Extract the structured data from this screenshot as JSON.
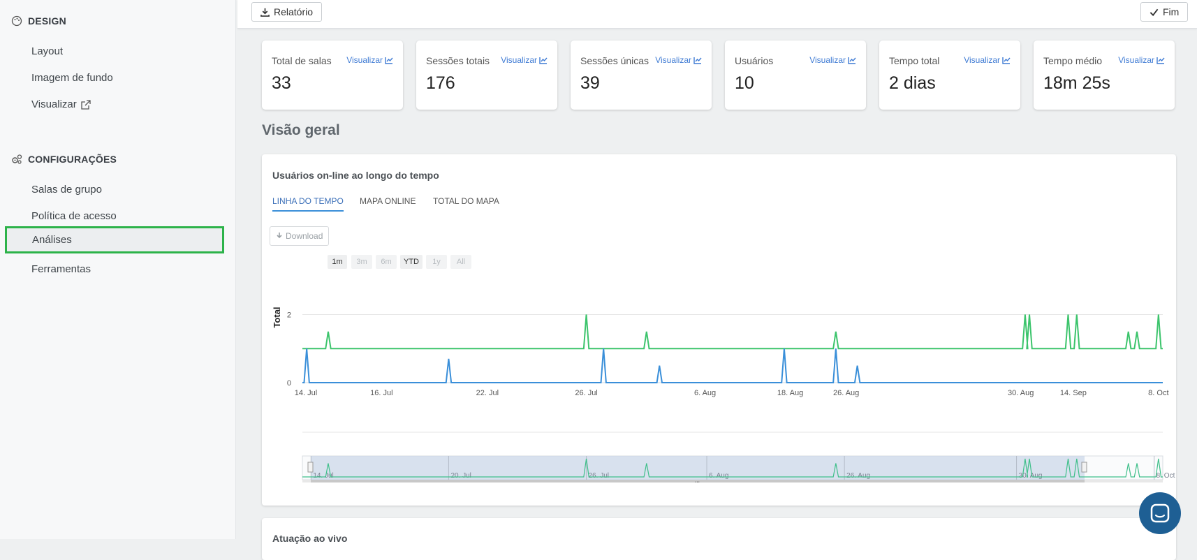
{
  "sidebar": {
    "design": {
      "title": "DESIGN",
      "icon": "palette-icon",
      "items": [
        {
          "label": "Layout"
        },
        {
          "label": "Imagem de fundo"
        },
        {
          "label": "Visualizar",
          "icon": "external-link-icon"
        }
      ]
    },
    "config": {
      "title": "CONFIGURAÇÕES",
      "icon": "gears-icon",
      "items": [
        {
          "label": "Salas de grupo"
        },
        {
          "label": "Política de acesso"
        },
        {
          "label": "Análises",
          "active": true
        },
        {
          "label": "Ferramentas"
        }
      ]
    }
  },
  "toolbar": {
    "report_label": "Relatório",
    "finish_label": "Fim"
  },
  "stats": [
    {
      "label": "Total de salas",
      "value": "33",
      "link": "Visualizar"
    },
    {
      "label": "Sessões totais",
      "value": "176",
      "link": "Visualizar"
    },
    {
      "label": "Sessões únicas",
      "value": "39",
      "link": "Visualizar"
    },
    {
      "label": "Usuários",
      "value": "10",
      "link": "Visualizar"
    },
    {
      "label": "Tempo total",
      "value": "2 dias",
      "link": "Visualizar"
    },
    {
      "label": "Tempo médio",
      "value": "18m 25s",
      "link": "Visualizar"
    }
  ],
  "overview_title": "Visão geral",
  "panel": {
    "title": "Usuários on-line ao longo do tempo",
    "tabs": [
      {
        "label": "LINHA DO TEMPO",
        "active": true
      },
      {
        "label": "MAPA ONLINE"
      },
      {
        "label": "TOTAL DO MAPA"
      }
    ],
    "download_label": "Download",
    "ranges": [
      {
        "label": "1m",
        "enabled": true
      },
      {
        "label": "3m",
        "enabled": false
      },
      {
        "label": "6m",
        "enabled": false
      },
      {
        "label": "YTD",
        "enabled": true
      },
      {
        "label": "1y",
        "enabled": false
      },
      {
        "label": "All",
        "enabled": false
      }
    ]
  },
  "panel2_title": "Atuação ao vivo",
  "colors": {
    "green_series": "#3cc46c",
    "blue_series": "#3a8fd9",
    "active_outline": "#2db34a",
    "link": "#3f7bd4",
    "chat": "#1e5f94"
  },
  "chart_data": {
    "type": "line",
    "ylabel": "Total",
    "yticks": [
      "0",
      "2"
    ],
    "ylim": [
      0,
      4
    ],
    "xticks": [
      "14. Jul",
      "16. Jul",
      "22. Jul",
      "26. Jul",
      "6. Aug",
      "18. Aug",
      "26. Aug",
      "30. Aug",
      "14. Sep",
      "8. Oct"
    ],
    "navigator_ticks": [
      "14. Jul",
      "20. Jul",
      "26. Jul",
      "6. Aug",
      "26. Aug",
      "30. Aug",
      "8. Oct"
    ],
    "series": [
      {
        "color": "#3cc46c",
        "baseline": 1,
        "spikes": [
          [
            0.03,
            1.5
          ],
          [
            0.33,
            2
          ],
          [
            0.4,
            1.5
          ],
          [
            0.62,
            1.5
          ],
          [
            0.84,
            2
          ],
          [
            0.845,
            2
          ],
          [
            0.89,
            2
          ],
          [
            0.9,
            2
          ],
          [
            0.96,
            1.5
          ],
          [
            0.97,
            1.5
          ],
          [
            0.995,
            2
          ]
        ]
      },
      {
        "color": "#3a8fd9",
        "baseline": 0,
        "spikes": [
          [
            0.005,
            1
          ],
          [
            0.17,
            0.7
          ],
          [
            0.35,
            1
          ],
          [
            0.415,
            0.5
          ],
          [
            0.56,
            1
          ],
          [
            0.62,
            1
          ],
          [
            0.645,
            0.5
          ]
        ]
      }
    ]
  }
}
